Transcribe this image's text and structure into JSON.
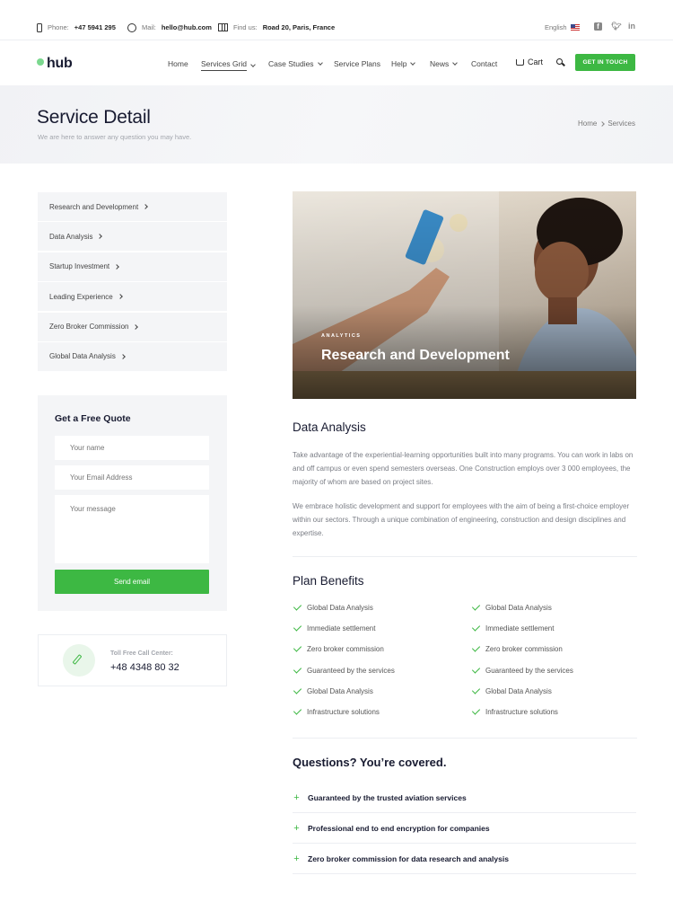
{
  "topbar": {
    "phone_label": "Phone:",
    "phone_value": "+47 5941 295",
    "mail_label": "Mail:",
    "mail_value": "hello@hub.com",
    "address_label": "Find us:",
    "address_value": "Road 20, Paris, France",
    "language": "English",
    "social": [
      "facebook-icon",
      "twitter-icon",
      "linkedin-icon"
    ]
  },
  "nav": {
    "logo": "hub",
    "items": [
      {
        "label": "Home",
        "dropdown": false
      },
      {
        "label": "Services Grid",
        "dropdown": true,
        "active": true
      },
      {
        "label": "Case Studies",
        "dropdown": true
      },
      {
        "label": "Service Plans",
        "dropdown": false
      },
      {
        "label": "Help",
        "dropdown": true
      },
      {
        "label": "News",
        "dropdown": true
      },
      {
        "label": "Contact",
        "dropdown": false
      }
    ],
    "cart_label": "Cart",
    "cta_label": "GET IN TOUCH"
  },
  "hero": {
    "title": "Service Detail",
    "subtitle": "We are here to answer any question you may have.",
    "breadcrumb": [
      "Home",
      "Services"
    ]
  },
  "sidebar": {
    "items": [
      "Research and Development",
      "Data Analysis",
      "Startup Investment",
      "Leading Experience",
      "Zero Broker Commission",
      "Global Data Analysis"
    ]
  },
  "quote_form": {
    "title": "Get a Free Quote",
    "name_placeholder": "Your name",
    "email_placeholder": "Your Email Address",
    "message_placeholder": "Your message",
    "submit_label": "Send email"
  },
  "call_box": {
    "label": "Toll Free Call Center:",
    "number": "+48 4348 80 32"
  },
  "feature": {
    "tag": "ANALYTICS",
    "title": "Research and Development"
  },
  "data_analysis": {
    "title": "Data Analysis",
    "paragraph1": "Take advantage of the experiential-learning opportunities built into many programs. You can work in labs on and off campus or even spend semesters overseas. One Construction employs over 3 000 employees, the majority of whom are based on project sites.",
    "paragraph2": "We embrace holistic development and support for employees with the aim of being a first-choice employer within our sectors. Through a unique combination of engineering, construction and design disciplines and expertise."
  },
  "benefits": {
    "title": "Plan Benefits",
    "left": [
      "Global Data Analysis",
      "Immediate settlement",
      "Zero broker commission",
      "Guaranteed by the services",
      "Global Data Analysis",
      "Infrastructure solutions"
    ],
    "right": [
      "Global Data Analysis",
      "Immediate settlement",
      "Zero broker commission",
      "Guaranteed by the services",
      "Global Data Analysis",
      "Infrastructure solutions"
    ]
  },
  "faq": {
    "title": "Questions? You’re covered.",
    "items": [
      "Guaranteed by the trusted aviation services",
      "Professional end to end encryption for companies",
      "Zero broker commission for data research and analysis"
    ]
  },
  "colors": {
    "accent": "#3db843",
    "heading": "#181b31",
    "panel": "#f4f5f7"
  }
}
